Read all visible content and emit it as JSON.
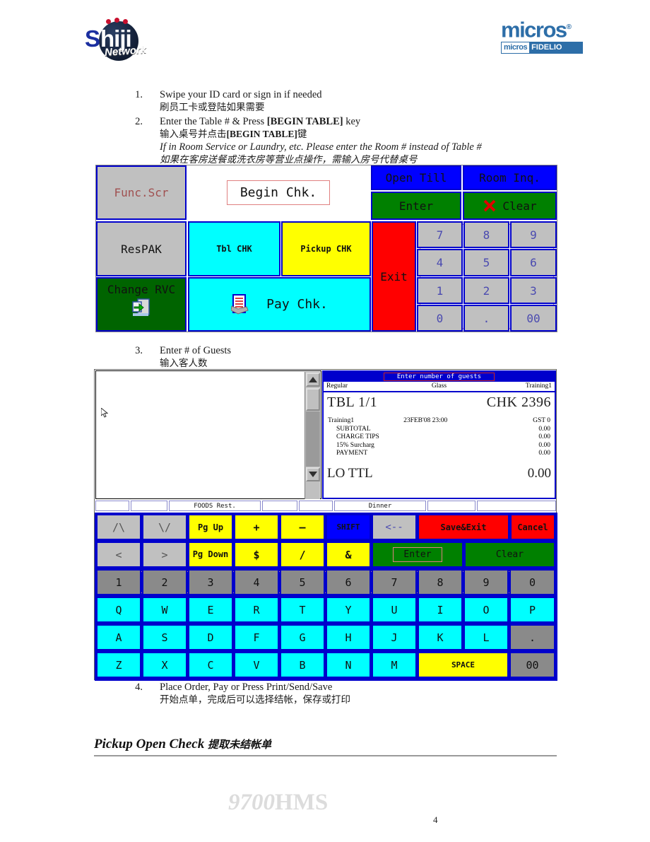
{
  "header": {
    "left_logo": {
      "name": "shiji-network-logo",
      "primary": "S",
      "secondary": "hiji",
      "tagline": "Network"
    },
    "right_logo": {
      "name": "micros-logo",
      "word": "micros",
      "reg": "®",
      "sub_left": "micros",
      "sub_right": "FIDELIO"
    }
  },
  "instructions": {
    "step1": {
      "num": "1.",
      "en": "Swipe your ID card or sign in if needed",
      "cn": "刷员工卡或登陆如果需要"
    },
    "step2": {
      "num": "2.",
      "en_pre": "Enter the Table # & Press ",
      "en_key": "[BEGIN TABLE]",
      "en_post": " key",
      "cn_pre": "输入桌号并点击",
      "cn_key": "[BEGIN TABLE]",
      "cn_post": "键",
      "note_en": "If in Room Service or Laundry, etc. Please enter the Room # instead of Table #",
      "note_cn": "如果在客房送餐或洗衣房等营业点操作，需输入房号代替桌号"
    },
    "step3": {
      "num": "3.",
      "en": "Enter # of Guests",
      "cn": "输入客人数"
    },
    "step4": {
      "num": "4.",
      "en": "Place Order, Pay or Press Print/Send/Save",
      "cn": "开始点单，完成后可以选择结帐，保存或打印"
    }
  },
  "pos_screen_1": {
    "name": "micros-9700-begin-check-screen",
    "buttons": {
      "func_scr": "Func.Scr",
      "begin_chk": "Begin Chk.",
      "open_till": "Open Till",
      "room_inq": "Room Inq.",
      "enter": "Enter",
      "clear": "Clear",
      "respak": "ResPAK",
      "tbl_chk": "Tbl CHK",
      "pickup_chk": "Pickup CHK",
      "exit": "Exit",
      "change_rvc": "Change RVC",
      "pay_chk": "Pay Chk."
    },
    "numpad": [
      "7",
      "8",
      "9",
      "4",
      "5",
      "6",
      "1",
      "2",
      "3",
      "0",
      ".",
      "00"
    ]
  },
  "pos_screen_2": {
    "name": "micros-9700-guest-count-screen",
    "check": {
      "dialog_title": "Enter number of guests",
      "sub_left": "Regular",
      "sub_mid": "Glass",
      "sub_right": "Training1",
      "table": "TBL 1/1",
      "check_no": "CHK 2396",
      "operator": "Training1",
      "datetime": "23FEB'08 23:00",
      "guest_count": "GST 0",
      "lines": [
        {
          "label": "SUBTOTAL",
          "value": "0.00"
        },
        {
          "label": "CHARGE TIPS",
          "value": "0.00"
        },
        {
          "label": "15% Surcharg",
          "value": "0.00"
        },
        {
          "label": "PAYMENT",
          "value": "0.00"
        }
      ],
      "total_label": "LO TTL",
      "total_value": "0.00"
    },
    "status_bar": [
      "",
      "",
      "FOODS Rest.",
      "",
      "",
      "Dinner",
      "",
      ""
    ],
    "keyboard": {
      "row1": [
        {
          "label": "/\\",
          "color": "grey"
        },
        {
          "label": "\\/",
          "color": "grey"
        },
        {
          "label": "Pg Up",
          "color": "yellow"
        },
        {
          "label": "+",
          "color": "yellow"
        },
        {
          "label": "–",
          "color": "yellow"
        },
        {
          "label": "SHIFT",
          "color": "blue"
        },
        {
          "label": "<--",
          "color": "grey"
        },
        {
          "label": "Save&Exit",
          "color": "red"
        },
        {
          "label": "Cancel",
          "color": "red"
        }
      ],
      "row2": [
        {
          "label": "<",
          "color": "grey"
        },
        {
          "label": ">",
          "color": "grey"
        },
        {
          "label": "Pg Down",
          "color": "yellow"
        },
        {
          "label": "$",
          "color": "yellow"
        },
        {
          "label": "/",
          "color": "yellow"
        },
        {
          "label": "&",
          "color": "yellow"
        },
        {
          "label": "Enter",
          "color": "green"
        },
        {
          "label": "Clear",
          "color": "green"
        }
      ],
      "row3": [
        "1",
        "2",
        "3",
        "4",
        "5",
        "6",
        "7",
        "8",
        "9",
        "0"
      ],
      "row4": [
        "Q",
        "W",
        "E",
        "R",
        "T",
        "Y",
        "U",
        "I",
        "O",
        "P"
      ],
      "row5": [
        "A",
        "S",
        "D",
        "F",
        "G",
        "H",
        "J",
        "K",
        "L",
        "."
      ],
      "row6": [
        "Z",
        "X",
        "C",
        "V",
        "B",
        "N",
        "M",
        "SPACE",
        "00"
      ]
    }
  },
  "footer": {
    "section_en": "Pickup Open Check",
    "section_cn": "提取未结帐单",
    "watermark_num": "9700",
    "watermark_txt": "HMS",
    "page_number": "4"
  },
  "colors": {
    "cyan": "#00ffff",
    "yellow": "#ffff00",
    "blue": "#0000ff",
    "green": "#008000",
    "red": "#ff0000",
    "grey": "#c0c0c0",
    "border_blue": "#0000cc"
  }
}
